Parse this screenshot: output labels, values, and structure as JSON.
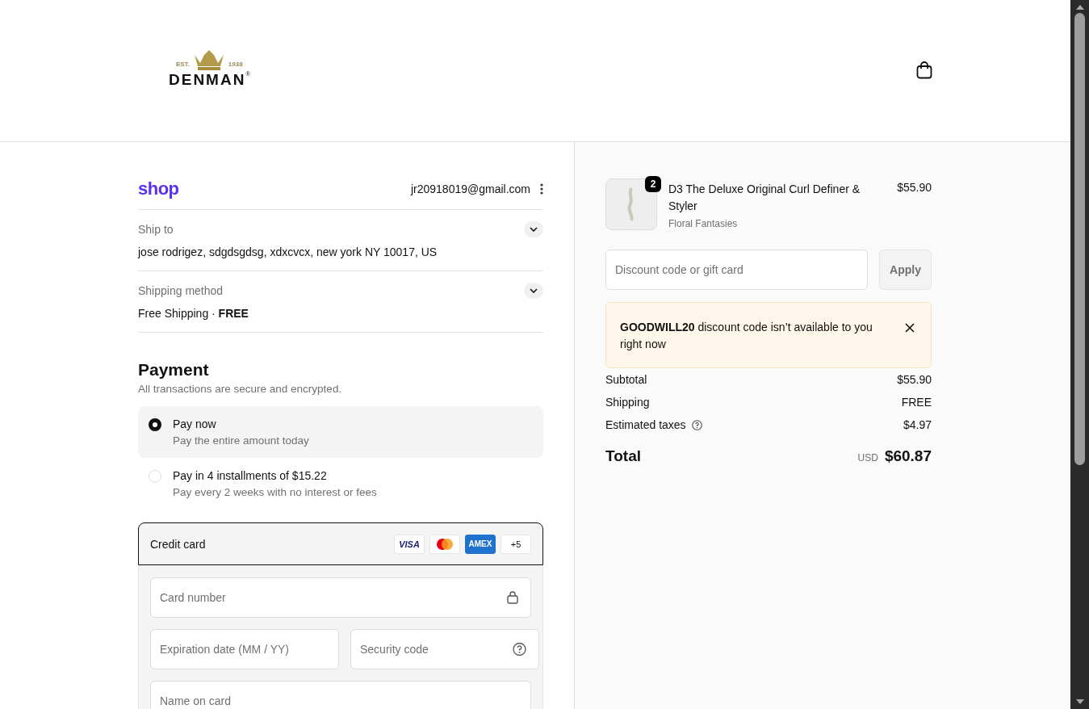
{
  "header": {
    "logo": {
      "est": "EST.",
      "year": "1938",
      "name": "DENMAN",
      "mark": "®"
    }
  },
  "account": {
    "brand": "shop",
    "email": "jr20918019@gmail.com"
  },
  "review": [
    {
      "label": "Ship to",
      "value": "jose rodrigez, sdgdsgdsg, xdxcvcx, new york NY 10017, US",
      "expanded": false
    },
    {
      "label": "Shipping method",
      "value": "Free Shipping · **FREE**",
      "expanded": false
    }
  ],
  "payment": {
    "title": "Payment",
    "subtitle": "All transactions are secure and encrypted.",
    "options": [
      {
        "title": "Pay now",
        "subtitle": "Pay the entire amount today",
        "selected": true
      },
      {
        "title": "Pay in 4 installments of $15.22",
        "subtitle": "Pay every 2 weeks with no interest or fees",
        "selected": false
      }
    ],
    "method": {
      "label": "Credit card",
      "brands": [
        {
          "kind": "visa",
          "label": "VISA"
        },
        {
          "kind": "mastercard"
        },
        {
          "kind": "amex",
          "label": "AMEX"
        },
        {
          "kind": "more",
          "label": "+5"
        }
      ]
    },
    "fields": [
      {
        "placeholder": "Card number",
        "kind": "number"
      },
      {
        "placeholder": "Expiration date (MM / YY)",
        "kind": "expiry"
      },
      {
        "placeholder": "Security code",
        "kind": "security"
      },
      {
        "placeholder": "Name on card",
        "kind": "name"
      }
    ]
  },
  "summary": {
    "item": {
      "quantity": "2",
      "name": "D3 The Deluxe Original Curl Definer & Styler",
      "variant": "Floral Fantasies",
      "price": "$55.90"
    },
    "discount": {
      "placeholder": "Discount code or gift card",
      "button": "Apply"
    },
    "alert": {
      "text": "**GOODWILL20** discount code isn’t available to you right now"
    },
    "lines": [
      {
        "label": "Subtotal",
        "value": "$55.90",
        "kind": "plain"
      },
      {
        "label": "Shipping",
        "value": "FREE",
        "kind": "plain"
      },
      {
        "label": "Estimated taxes",
        "value": "$4.97",
        "kind": "help"
      }
    ],
    "total": {
      "label": "Total",
      "currency": "USD",
      "amount": "$60.87"
    }
  }
}
